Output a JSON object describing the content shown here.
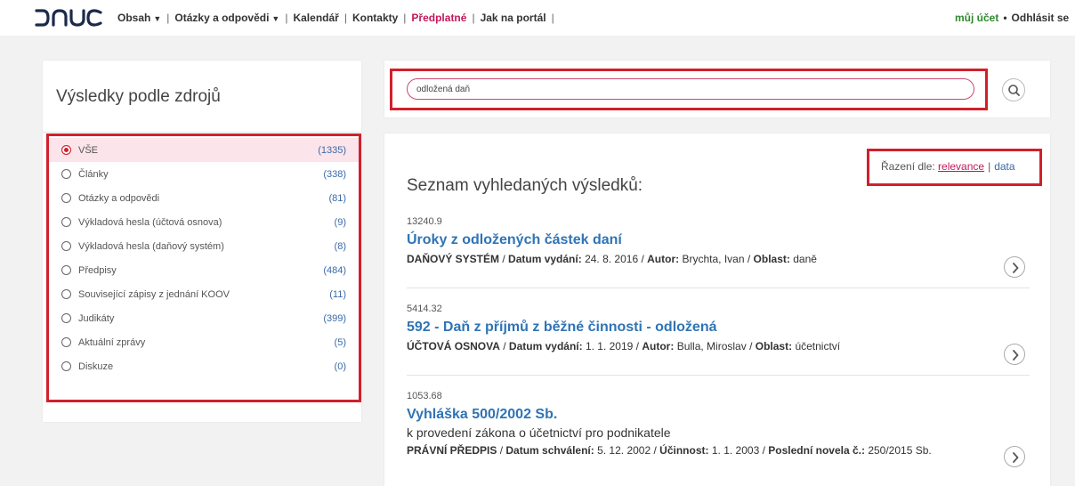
{
  "nav": {
    "logo_text": "DAUC",
    "items": [
      {
        "label": "Obsah",
        "caret": true,
        "accent": false
      },
      {
        "label": "Otázky a odpovědi",
        "caret": true,
        "accent": false
      },
      {
        "label": "Kalendář",
        "caret": false,
        "accent": false
      },
      {
        "label": "Kontakty",
        "caret": false,
        "accent": false
      },
      {
        "label": "Předplatné",
        "caret": false,
        "accent": true
      },
      {
        "label": "Jak na portál",
        "caret": false,
        "accent": false
      }
    ],
    "account": "můj účet",
    "logout": "Odhlásit se"
  },
  "sources": {
    "title": "Výsledky podle zdrojů",
    "items": [
      {
        "label": "VŠE",
        "count": "(1335)",
        "selected": true
      },
      {
        "label": "Články",
        "count": "(338)",
        "selected": false
      },
      {
        "label": "Otázky a odpovědi",
        "count": "(81)",
        "selected": false
      },
      {
        "label": "Výkladová hesla (účtová osnova)",
        "count": "(9)",
        "selected": false
      },
      {
        "label": "Výkladová hesla (daňový systém)",
        "count": "(8)",
        "selected": false
      },
      {
        "label": "Předpisy",
        "count": "(484)",
        "selected": false
      },
      {
        "label": "Související zápisy z jednání KOOV",
        "count": "(11)",
        "selected": false
      },
      {
        "label": "Judikáty",
        "count": "(399)",
        "selected": false
      },
      {
        "label": "Aktuální zprávy",
        "count": "(5)",
        "selected": false
      },
      {
        "label": "Diskuze",
        "count": "(0)",
        "selected": false
      }
    ]
  },
  "search": {
    "value": "odložená daň"
  },
  "sort": {
    "prefix": "Řazení dle:",
    "active": "relevance",
    "separator": "|",
    "other": "data"
  },
  "results": {
    "title": "Seznam vyhledaných výsledků:",
    "items": [
      {
        "score": "13240.9",
        "title": "Úroky z odložených částek daní",
        "subtitle": "",
        "meta": [
          {
            "k": "DAŇOVÝ SYSTÉM",
            "v": ""
          },
          {
            "k": "Datum vydání:",
            "v": "24. 8. 2016"
          },
          {
            "k": "Autor:",
            "v": "Brychta, Ivan"
          },
          {
            "k": "Oblast:",
            "v": "daně"
          }
        ]
      },
      {
        "score": "5414.32",
        "title": "592 - Daň z příjmů z běžné činnosti - odložená",
        "subtitle": "",
        "meta": [
          {
            "k": "ÚČTOVÁ OSNOVA",
            "v": ""
          },
          {
            "k": "Datum vydání:",
            "v": "1. 1. 2019"
          },
          {
            "k": "Autor:",
            "v": "Bulla, Miroslav"
          },
          {
            "k": "Oblast:",
            "v": "účetnictví"
          }
        ]
      },
      {
        "score": "1053.68",
        "title": "Vyhláška 500/2002 Sb.",
        "subtitle": "k provedení zákona o účetnictví pro podnikatele",
        "meta": [
          {
            "k": "PRÁVNÍ PŘEDPIS",
            "v": ""
          },
          {
            "k": "Datum schválení:",
            "v": "5. 12. 2002"
          },
          {
            "k": "Účinnost:",
            "v": "1. 1. 2003"
          },
          {
            "k": "Poslední novela č.:",
            "v": "250/2015 Sb."
          }
        ]
      }
    ]
  },
  "colors": {
    "accent": "#c2185b",
    "highlight_box": "#d0202c",
    "link_blue": "#2f74b5",
    "account_green": "#2e8b2e"
  }
}
